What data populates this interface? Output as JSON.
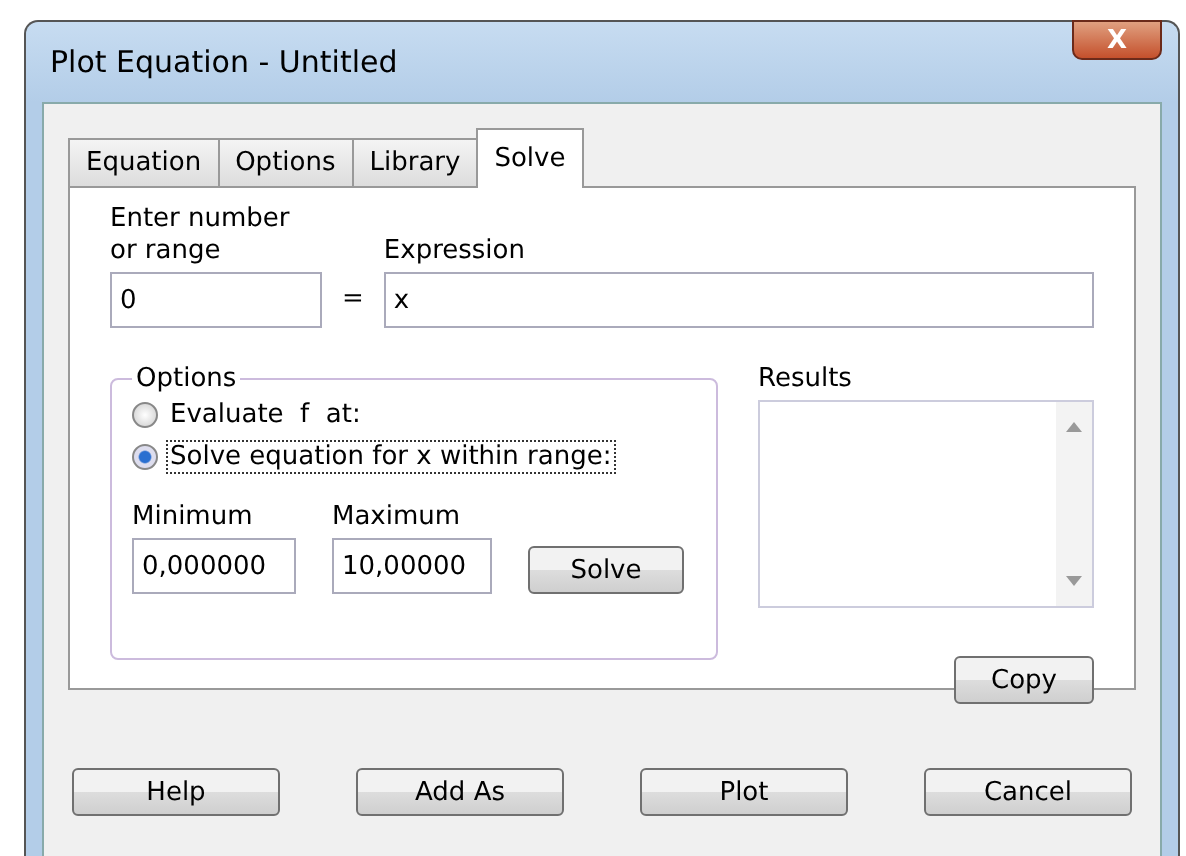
{
  "window": {
    "title": "Plot Equation - Untitled",
    "close": "X"
  },
  "tabs": [
    {
      "label": "Equation",
      "selected": false
    },
    {
      "label": "Options",
      "selected": false
    },
    {
      "label": "Library",
      "selected": false
    },
    {
      "label": "Solve",
      "selected": true
    }
  ],
  "entry": {
    "label": "Enter number or range",
    "value": "0",
    "equals": "=",
    "expression_label": "Expression",
    "expression": "x"
  },
  "options": {
    "title": "Options",
    "radios": [
      {
        "label": "Evaluate  f  at:",
        "selected": false
      },
      {
        "label": "Solve equation for x within range:",
        "selected": true
      }
    ],
    "minimum": {
      "label": "Minimum",
      "value": "0,000000"
    },
    "maximum": {
      "label": "Maximum",
      "value": "10,00000"
    },
    "solve_button": "Solve"
  },
  "results": {
    "label": "Results",
    "copy_button": "Copy"
  },
  "buttons": [
    "Help",
    "Add As",
    "Plot",
    "Cancel"
  ]
}
